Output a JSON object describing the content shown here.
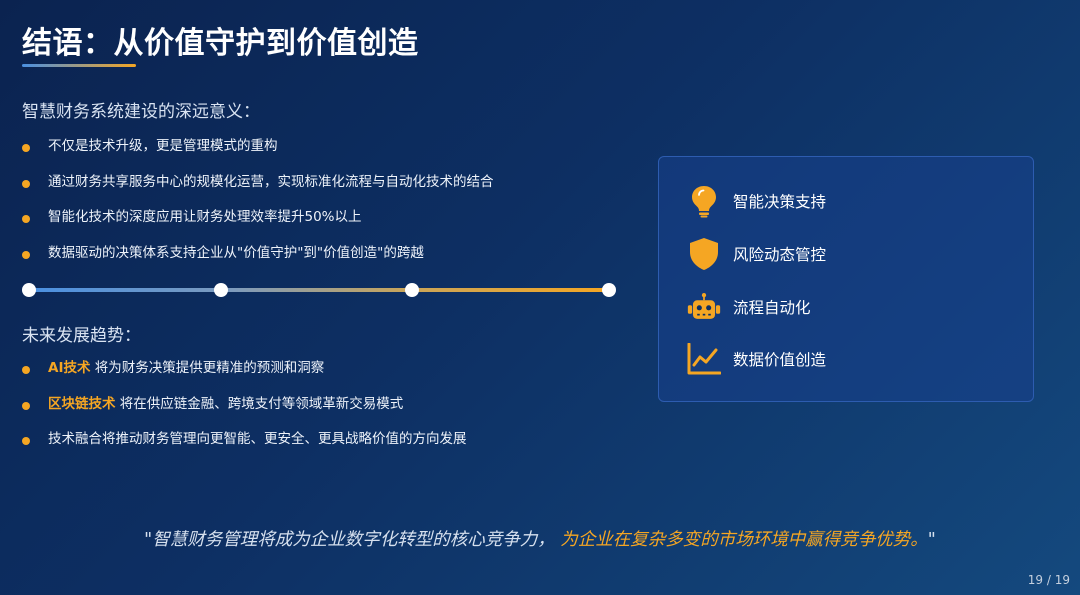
{
  "slide": {
    "title": "结语：从价值守护到价值创造",
    "section1_heading": "智慧财务系统建设的深远意义：",
    "section1_items": [
      "不仅是技术升级，更是管理模式的重构",
      "通过财务共享服务中心的规模化运营，实现标准化流程与自动化技术的结合",
      "智能化技术的深度应用让财务处理效率提升50%以上",
      "数据驱动的决策体系支持企业从\"价值守护\"到\"价值创造\"的跨越"
    ],
    "section2_heading": "未来发展趋势：",
    "section2_items": [
      {
        "highlight": "AI技术",
        "text": " 将为财务决策提供更精准的预测和洞察"
      },
      {
        "highlight": "区块链技术",
        "text": " 将在供应链金融、跨境支付等领域革新交易模式"
      },
      {
        "highlight": "",
        "text": "技术融合将推动财务管理向更智能、更安全、更具战略价值的方向发展"
      }
    ],
    "card_items": [
      {
        "label": "智能决策支持",
        "icon": "lightbulb-icon"
      },
      {
        "label": "风险动态管控",
        "icon": "shield-icon"
      },
      {
        "label": "流程自动化",
        "icon": "robot-icon"
      },
      {
        "label": "数据价值创造",
        "icon": "line-chart-icon"
      }
    ],
    "quote_part1": "\"智慧财务管理将成为企业数字化转型的核心竞争力，",
    "quote_part2": "为企业在复杂多变的市场环境中赢得竞争优势。",
    "quote_end": "\"",
    "page_number": "19 / 19"
  },
  "colors": {
    "accent": "#f5a623",
    "accent_blue": "#4a90e2",
    "background_dark": "#0b2350",
    "background_light": "#14497e"
  }
}
